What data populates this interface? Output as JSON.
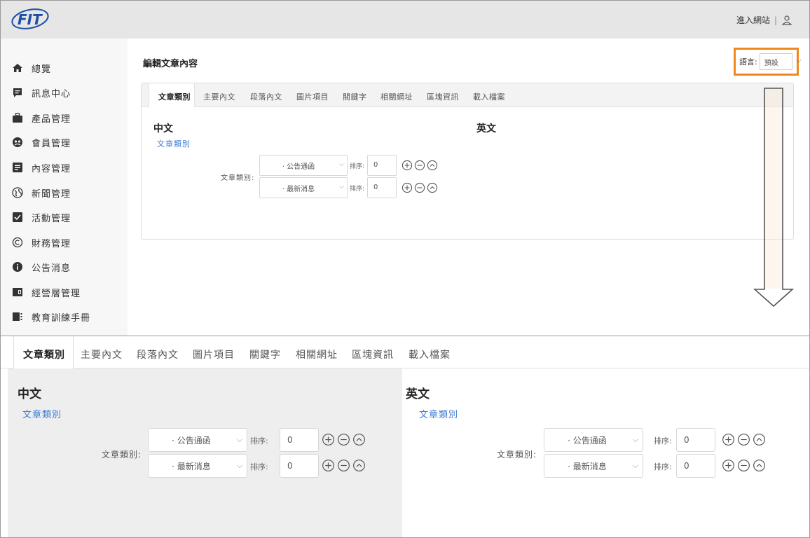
{
  "header": {
    "enter_site": "進入網站",
    "separator": "|"
  },
  "sidebar": {
    "items": [
      {
        "label": "總覽",
        "icon": "home-icon"
      },
      {
        "label": "訊息中心",
        "icon": "message-icon"
      },
      {
        "label": "產品管理",
        "icon": "briefcase-icon"
      },
      {
        "label": "會員管理",
        "icon": "member-icon"
      },
      {
        "label": "內容管理",
        "icon": "list-icon"
      },
      {
        "label": "新聞管理",
        "icon": "globe-icon"
      },
      {
        "label": "活動管理",
        "icon": "checkbox-icon"
      },
      {
        "label": "財務管理",
        "icon": "copyright-icon"
      },
      {
        "label": "公告消息",
        "icon": "info-icon"
      },
      {
        "label": "經營層管理",
        "icon": "panel-icon"
      },
      {
        "label": "教育訓練手冊",
        "icon": "manual-icon"
      }
    ]
  },
  "main": {
    "title": "編輯文章內容",
    "language_label": "語言:",
    "language_value": "預設"
  },
  "tabs": [
    "文章類別",
    "主要內文",
    "段落內文",
    "圖片項目",
    "關鍵字",
    "相關網址",
    "區塊資訊",
    "載入檔案"
  ],
  "columns": {
    "zh": {
      "title": "中文",
      "subtitle": "文章類別"
    },
    "en": {
      "title": "英文",
      "subtitle": "文章類別"
    }
  },
  "category_field": {
    "label": "文章類別:",
    "rows": [
      {
        "select": "· 公告通函",
        "sort_label": "排序:",
        "sort_value": "0"
      },
      {
        "select": "· 最新消息",
        "sort_label": "排序:",
        "sort_value": "0"
      }
    ]
  },
  "colors": {
    "highlight": "#f0891b",
    "link": "#3a7bd5",
    "header_bg": "#e6e6e6"
  }
}
